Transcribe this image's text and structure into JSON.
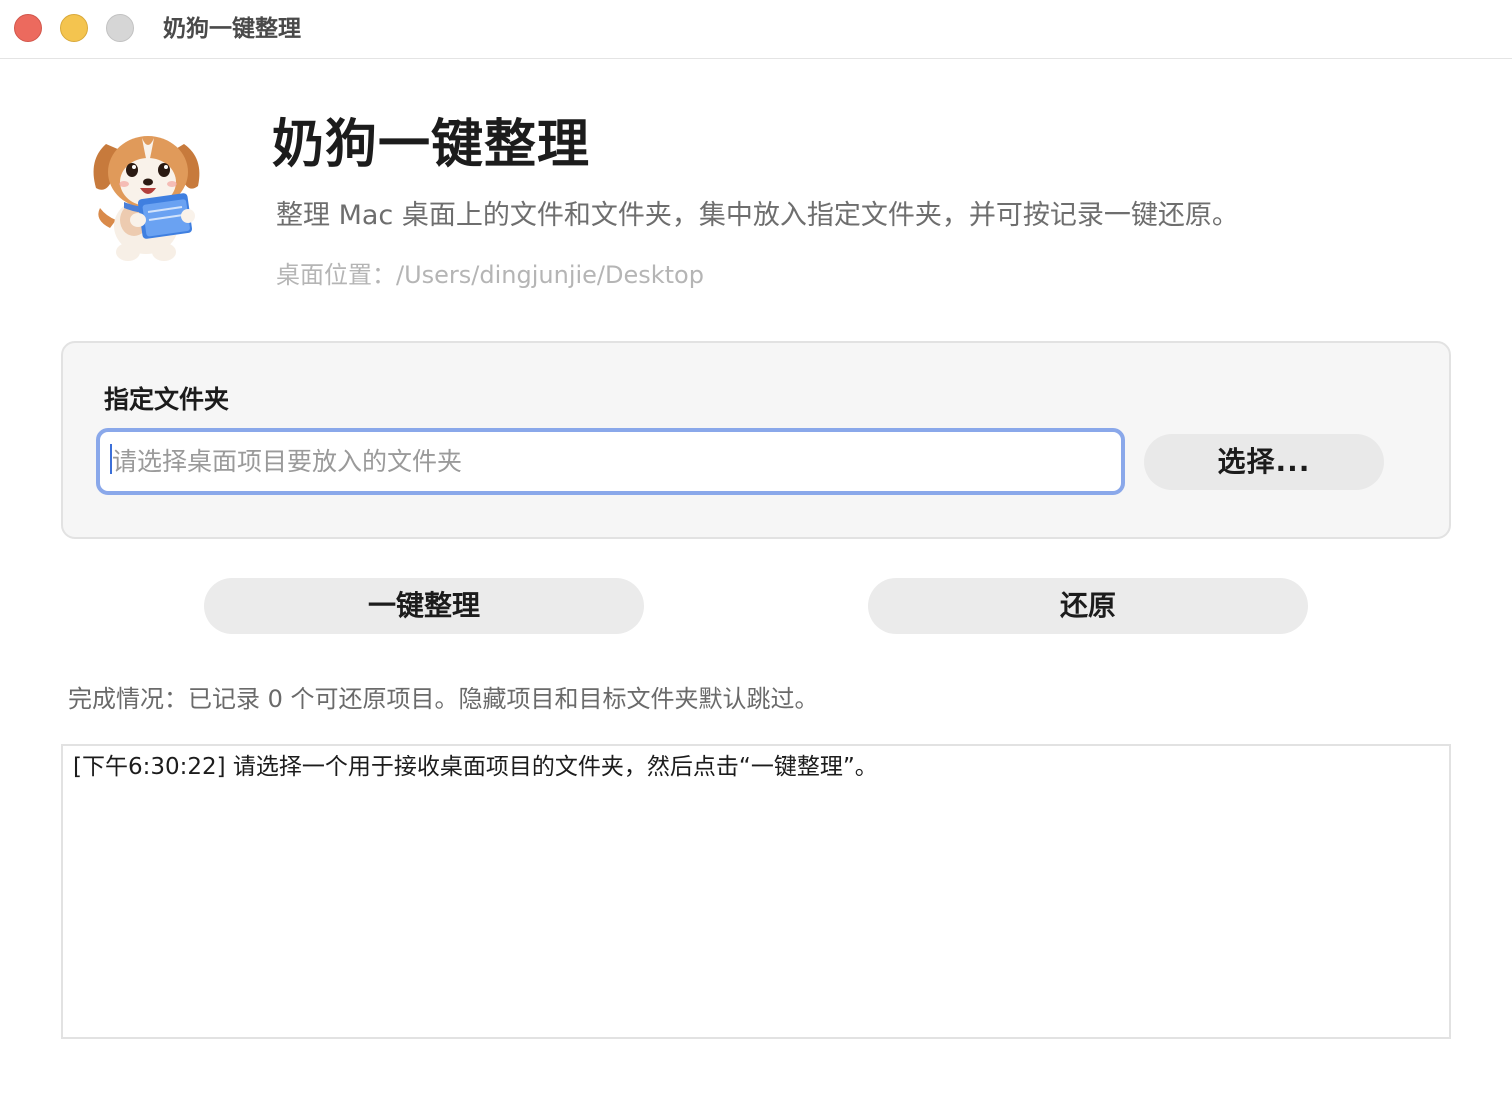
{
  "window": {
    "title": "奶狗一键整理"
  },
  "header": {
    "mascot_icon": "puppy-holding-folder-icon",
    "title": "奶狗一键整理",
    "subtitle": "整理 Mac 桌面上的文件和文件夹，集中放入指定文件夹，并可按记录一键还原。",
    "desktop_path": "桌面位置：/Users/dingjunjie/Desktop"
  },
  "folder_panel": {
    "label": "指定文件夹",
    "input_value": "",
    "input_placeholder": "请选择桌面项目要放入的文件夹",
    "choose_label": "选择..."
  },
  "actions": {
    "organize_label": "一键整理",
    "restore_label": "还原"
  },
  "status": {
    "text": "完成情况：已记录 0 个可还原项目。隐藏项目和目标文件夹默认跳过。"
  },
  "log": {
    "lines": [
      "[下午6:30:22] 请选择一个用于接收桌面项目的文件夹，然后点击“一键整理”。"
    ]
  },
  "colors": {
    "close": "#ec6a5e",
    "minimize": "#f4c44f",
    "maximize": "#d6d6d6",
    "input_focus_ring": "#8aa8ea",
    "button_bg": "#ebebeb",
    "panel_bg": "#f6f6f6"
  }
}
